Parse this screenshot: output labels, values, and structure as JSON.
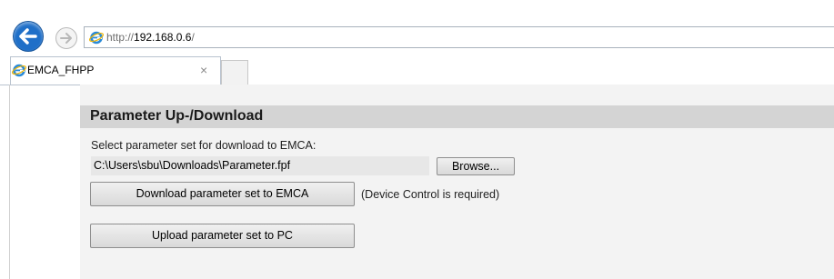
{
  "browser": {
    "address": {
      "scheme": "http://",
      "host": "192.168.0.6",
      "path": "/"
    },
    "tab": {
      "title": "EMCA_FHPP",
      "close_glyph": "×"
    },
    "icons": {
      "back": "back-arrow-icon",
      "forward": "forward-arrow-icon",
      "site": "internet-explorer-icon"
    },
    "colors": {
      "back_button": "#1f6fc8",
      "ie_blue": "#2a8ad8"
    }
  },
  "panel": {
    "title": "Parameter Up-/Download",
    "instruction": "Select parameter set for download to EMCA:",
    "file_path": "C:\\Users\\sbu\\Downloads\\Parameter.fpf",
    "browse_label": "Browse...",
    "download_label": "Download parameter set to EMCA",
    "download_note": "(Device Control is required)",
    "upload_label": "Upload parameter set to PC",
    "colors": {
      "header_bg": "#d4d4d4",
      "panel_bg": "#f3f3f3"
    }
  }
}
